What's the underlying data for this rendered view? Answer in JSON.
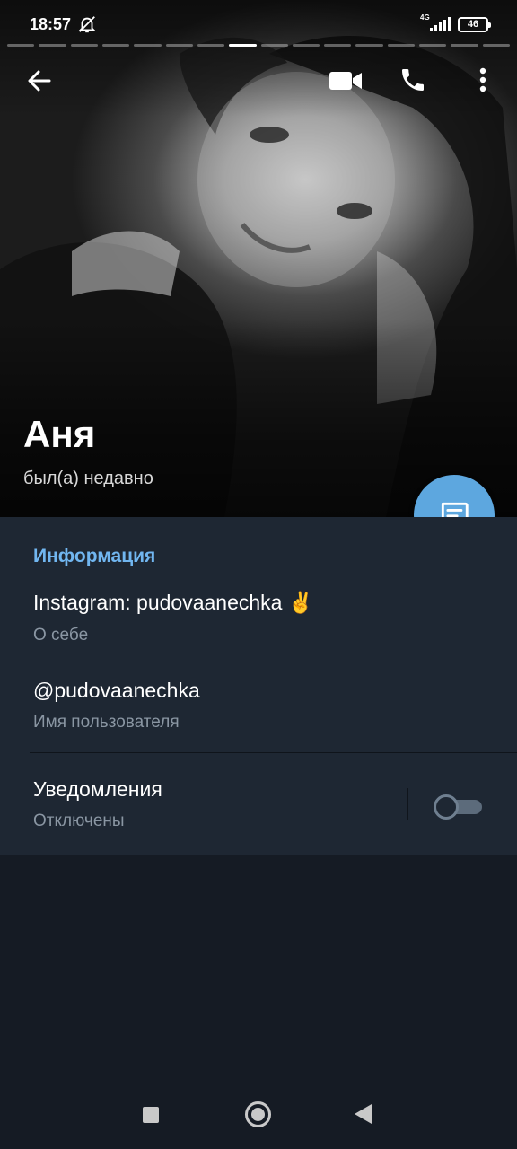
{
  "status_bar": {
    "time": "18:57",
    "network": "4G",
    "battery": "46"
  },
  "story_progress": {
    "segments": 16,
    "active_index": 7
  },
  "toolbar": {
    "back_icon": "arrow-left-icon",
    "video_icon": "video-camera-icon",
    "call_icon": "phone-icon",
    "more_icon": "more-vertical-icon"
  },
  "profile": {
    "name": "Аня",
    "last_seen": "был(а) недавно"
  },
  "fab_icon": "message-icon",
  "info": {
    "section_title": "Информация",
    "bio": {
      "value": "Instagram: pudovaanechka ✌️",
      "label": "О себе"
    },
    "username": {
      "value": "@pudovaanechka",
      "label": "Имя пользователя"
    },
    "notifications": {
      "title": "Уведомления",
      "state": "Отключены",
      "enabled": false
    }
  },
  "colors": {
    "accent": "#5da7df",
    "section_title": "#71b6f0",
    "card_bg": "#1e2733",
    "page_bg": "#151b24",
    "secondary_text": "#8a96a3"
  }
}
